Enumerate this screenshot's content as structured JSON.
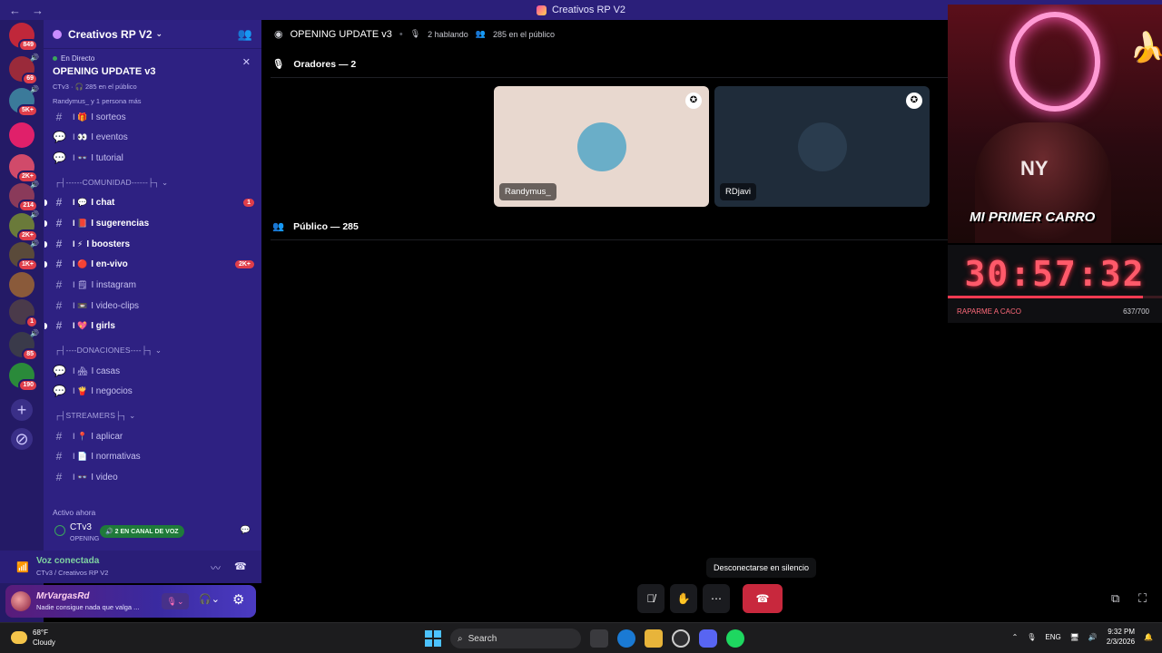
{
  "window": {
    "title": "Creativos RP V2"
  },
  "servers": [
    {
      "badge": "849",
      "color": "#c0273a"
    },
    {
      "badge": "69",
      "color": "#9a2a3a",
      "speaker": true
    },
    {
      "badge": "5K+",
      "color": "#3b7a9a",
      "speaker": true
    },
    {
      "badge": "",
      "color": "#e0206a"
    },
    {
      "badge": "2K+",
      "color": "#d14a6a"
    },
    {
      "badge": "214",
      "color": "#8a3a5a",
      "speaker": true
    },
    {
      "badge": "2K+",
      "color": "#6a7a3a",
      "speaker": true
    },
    {
      "badge": "1K+",
      "color": "#5a4a3a",
      "speaker": true
    },
    {
      "badge": "",
      "color": "#8a5a3a"
    },
    {
      "badge": "1",
      "color": "#4a3a4a"
    },
    {
      "badge": "85",
      "color": "#3a3a4a",
      "speaker": true
    },
    {
      "badge": "190",
      "color": "#2a8a3a"
    }
  ],
  "guild": {
    "name": "Creativos RP V2"
  },
  "live": {
    "status": "En Directo",
    "title": "OPENING UPDATE v3",
    "sub": "CTv3 · 🎧 285 en el público",
    "people": "Randymus_ y 1 persona más"
  },
  "channels": [
    {
      "name": "I sorteos",
      "emoji": "🎁",
      "unread": false
    },
    {
      "name": "I eventos",
      "emoji": "👀",
      "unread": false,
      "type": "forum"
    },
    {
      "name": "I tutorial",
      "emoji": "👓",
      "unread": false,
      "type": "forum"
    },
    {
      "name": "I chat",
      "emoji": "💬",
      "unread": true,
      "count": "1"
    },
    {
      "name": "I sugerencias",
      "emoji": "📕",
      "unread": true
    },
    {
      "name": "I boosters",
      "emoji": "⚡",
      "unread": true
    },
    {
      "name": "I en-vivo",
      "emoji": "🔴",
      "unread": true,
      "count": "2K+"
    },
    {
      "name": "I instagram",
      "emoji": "🗒",
      "unread": false
    },
    {
      "name": "I video-clips",
      "emoji": "📼",
      "unread": false
    },
    {
      "name": "I girls",
      "emoji": "💖",
      "unread": true
    },
    {
      "name": "I casas",
      "emoji": "🏘",
      "unread": false,
      "type": "forum"
    },
    {
      "name": "I negocios",
      "emoji": "🍟",
      "unread": false,
      "type": "forum"
    },
    {
      "name": "I aplicar",
      "emoji": "📍",
      "unread": false
    },
    {
      "name": "I normativas",
      "emoji": "📄",
      "unread": false
    },
    {
      "name": "I video",
      "emoji": "👓",
      "unread": false
    }
  ],
  "categories": [
    "┌┤------COMUNIDAD------├┐",
    "┌┤----DONACIONES----├┐",
    "┌┤STREAMERS├┐"
  ],
  "active_now": {
    "heading": "Activo ahora",
    "name": "CTv3",
    "sub": "OPENING",
    "badge": "🔊 2 EN CANAL DE VOZ"
  },
  "voice": {
    "status": "Voz conectada",
    "location": "CTv3 / Creativos RP V2"
  },
  "user": {
    "name": "MrVargasRd",
    "status": "Nadie consigue nada que valga ..."
  },
  "stage": {
    "title": "OPENING UPDATE v3",
    "speaking": "2 hablando",
    "audience": "285 en el público",
    "speakers_heading": "Oradores — 2",
    "public_heading": "Público — 285",
    "speakers": [
      {
        "name": "Randymus_",
        "bg": "#e8d8cf",
        "avatar_bg": "#6aaec8"
      },
      {
        "name": "RDjavi",
        "bg": "#1f2c3a",
        "avatar_bg": "#2a3c4e"
      }
    ]
  },
  "tooltip": "Desconectarse en silencio",
  "stream": {
    "overlay": "MI PRIMER CARRO",
    "timer": "30:57:32",
    "label": "RAPARME A CACO",
    "count": "637/700",
    "progress": 0.91
  },
  "taskbar": {
    "temp": "68°F",
    "weather": "Cloudy",
    "search": "Search",
    "lang": "ENG",
    "time": "9:32 PM",
    "date": "2/3/2026"
  }
}
